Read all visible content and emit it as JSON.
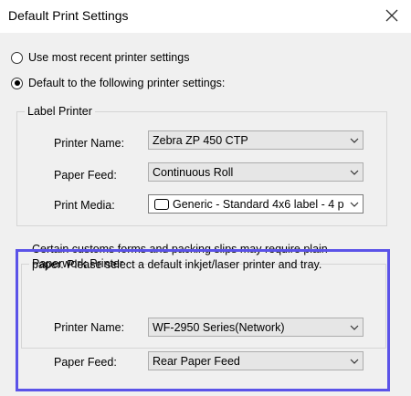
{
  "window": {
    "title": "Default Print Settings"
  },
  "options": {
    "recent_label": "Use most recent printer settings",
    "recent_checked": false,
    "following_label": "Default to the following printer settings:",
    "following_checked": true
  },
  "label_printer": {
    "group_title": "Label Printer",
    "printer_name_label": "Printer Name:",
    "printer_name_value": "Zebra ZP 450 CTP",
    "paper_feed_label": "Paper Feed:",
    "paper_feed_value": "Continuous Roll",
    "print_media_label": "Print Media:",
    "print_media_value": "Generic - Standard 4x6 label - 4 p"
  },
  "paperwork_printer": {
    "group_title": "Paperwork Printer",
    "description_line1": "Certain customs forms and packing slips may require plain",
    "description_line2": "paper. Please select a default inkjet/laser printer and tray.",
    "printer_name_label": "Printer Name:",
    "printer_name_value": "WF-2950 Series(Network)",
    "paper_feed_label": "Paper Feed:",
    "paper_feed_value": "Rear Paper Feed"
  },
  "colors": {
    "highlight": "#5b53e8"
  },
  "icons": {
    "close": "close-icon",
    "dropdown": "chevron-down-icon",
    "media": "label-media-icon"
  }
}
